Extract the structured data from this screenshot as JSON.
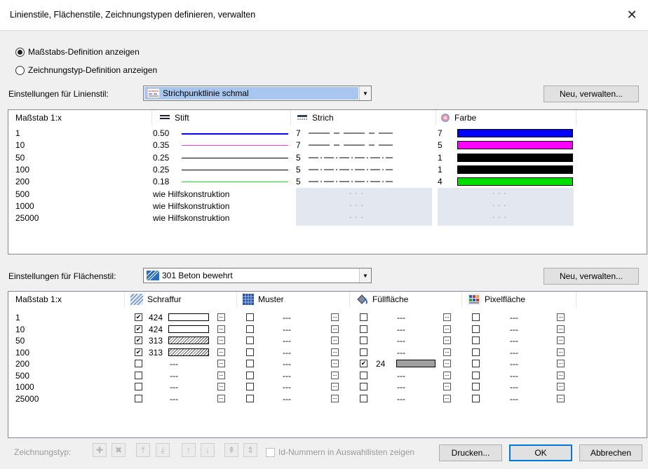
{
  "window": {
    "title": "Linienstile, Flächenstile, Zeichnungstypen definieren, verwalten",
    "close": "✕"
  },
  "radios": [
    {
      "label": "Maßstabs-Definition anzeigen",
      "checked": true
    },
    {
      "label": "Zeichnungstyp-Definition anzeigen",
      "checked": false
    }
  ],
  "linestyle": {
    "label": "Einstellungen für Linienstil:",
    "combo_value": "Strichpunktlinie schmal",
    "button": "Neu, verwalten...",
    "columns": [
      "Maßstab 1:x",
      "Stift",
      "Strich",
      "Farbe"
    ],
    "rows": [
      {
        "scale": "1",
        "pen": "0.50",
        "pen_color": "#0000ff",
        "stroke": "7",
        "stroke_pattern": "dash-long",
        "color_num": "7",
        "color": "#0000ff"
      },
      {
        "scale": "10",
        "pen": "0.35",
        "pen_color": "#ff33ff",
        "stroke": "7",
        "stroke_pattern": "dash-long",
        "color_num": "5",
        "color": "#ff00ff"
      },
      {
        "scale": "50",
        "pen": "0.25",
        "pen_color": "#000000",
        "stroke": "5",
        "stroke_pattern": "dash-dot",
        "color_num": "1",
        "color": "#000000"
      },
      {
        "scale": "100",
        "pen": "0.25",
        "pen_color": "#000000",
        "stroke": "5",
        "stroke_pattern": "dash-dot",
        "color_num": "1",
        "color": "#000000"
      },
      {
        "scale": "200",
        "pen": "0.18",
        "pen_color": "#22dd22",
        "stroke": "5",
        "stroke_pattern": "dash-dot",
        "color_num": "4",
        "color": "#00dd00"
      },
      {
        "scale": "500",
        "pen": "wie Hilfskonstruktion",
        "stroke": "- - -",
        "color_num": "- - -"
      },
      {
        "scale": "1000",
        "pen": "wie Hilfskonstruktion",
        "stroke": "- - -",
        "color_num": "- - -"
      },
      {
        "scale": "25000",
        "pen": "wie Hilfskonstruktion",
        "stroke": "- - -",
        "color_num": "- - -"
      }
    ]
  },
  "areastyle": {
    "label": "Einstellungen für Flächenstil:",
    "combo_value": "301 Beton bewehrt",
    "button": "Neu, verwalten...",
    "columns": [
      "Maßstab 1:x",
      "Schraffur",
      "Muster",
      "Füllfläche",
      "Pixelfläche"
    ],
    "rows": [
      {
        "scale": "1",
        "hatch_on": true,
        "hatch": "424",
        "hatch_style": "blank",
        "pattern": "---",
        "fill_on": false,
        "fill": "---",
        "pixel": "---"
      },
      {
        "scale": "10",
        "hatch_on": true,
        "hatch": "424",
        "hatch_style": "blank",
        "pattern": "---",
        "fill_on": false,
        "fill": "---",
        "pixel": "---"
      },
      {
        "scale": "50",
        "hatch_on": true,
        "hatch": "313",
        "hatch_style": "hatched",
        "pattern": "---",
        "fill_on": false,
        "fill": "---",
        "pixel": "---"
      },
      {
        "scale": "100",
        "hatch_on": true,
        "hatch": "313",
        "hatch_style": "hatched",
        "pattern": "---",
        "fill_on": false,
        "fill": "---",
        "pixel": "---"
      },
      {
        "scale": "200",
        "hatch_on": false,
        "hatch": "---",
        "pattern": "---",
        "fill_on": true,
        "fill": "24",
        "fill_color": "#a0a0a0",
        "pixel": "---"
      },
      {
        "scale": "500",
        "hatch_on": false,
        "hatch": "---",
        "pattern": "---",
        "fill_on": false,
        "fill": "---",
        "pixel": "---"
      },
      {
        "scale": "1000",
        "hatch_on": false,
        "hatch": "---",
        "pattern": "---",
        "fill_on": false,
        "fill": "---",
        "pixel": "---"
      },
      {
        "scale": "25000",
        "hatch_on": false,
        "hatch": "---",
        "pattern": "---",
        "fill_on": false,
        "fill": "---",
        "pixel": "---"
      }
    ]
  },
  "footer": {
    "label": "Zeichnungstyp:",
    "toolbar_icons": [
      "add-icon",
      "delete-icon",
      "move-top-icon",
      "move-bottom-icon",
      "move-up-icon",
      "move-down-icon",
      "sort-top-icon",
      "sort-icon"
    ],
    "checkbox_label": "Id-Nummern in Auswahllisten zeigen",
    "print": "Drucken...",
    "ok": "OK",
    "cancel": "Abbrechen"
  }
}
